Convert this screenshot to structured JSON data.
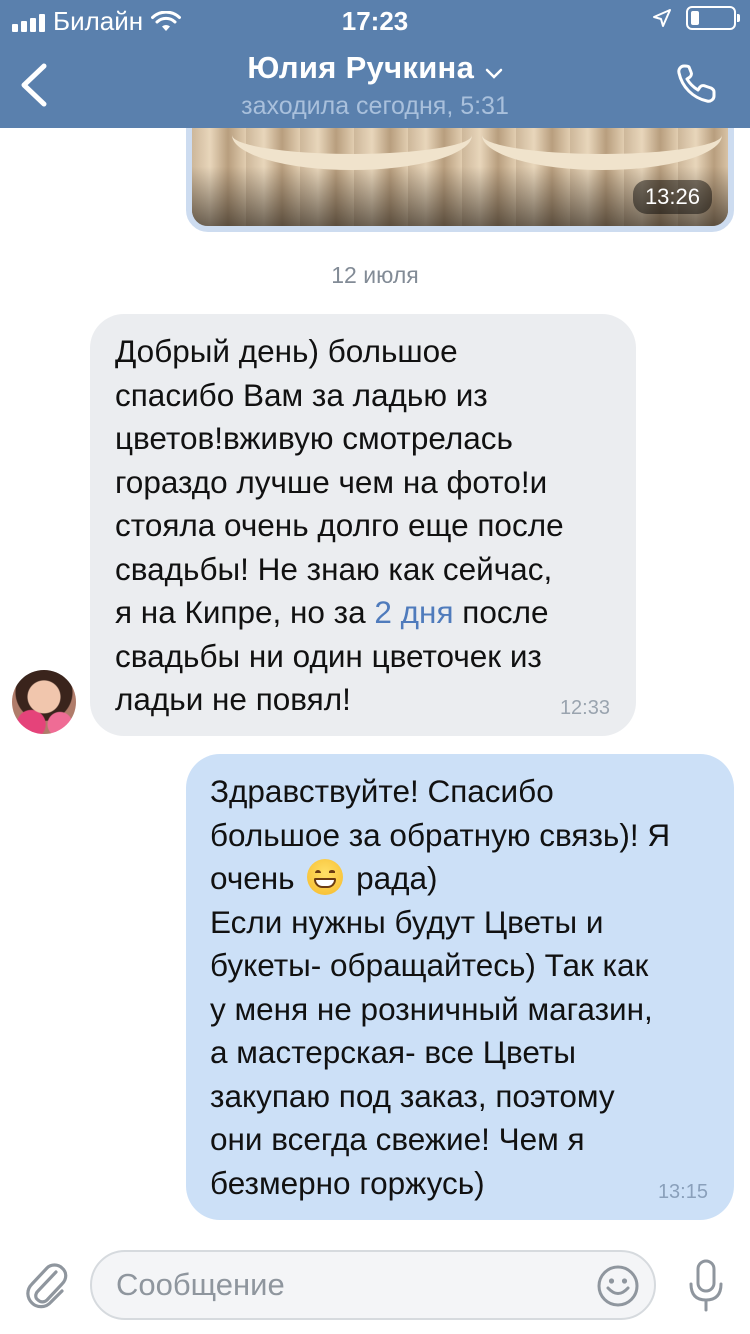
{
  "status_bar": {
    "carrier": "Билайн",
    "time": "17:23"
  },
  "header": {
    "contact_name": "Юлия Ручкина",
    "last_seen": "заходила сегодня, 5:31"
  },
  "photo_message": {
    "time": "13:26"
  },
  "date_separator": "12 июля",
  "incoming_message": {
    "lines": [
      "Добрый день) большое",
      "спасибо Вам за ладью из",
      "цветов!вживую смотрелась",
      "гораздо лучше чем на фото!и",
      "стояла очень долго еще после",
      "свадьбы! Не знаю как сейчас,",
      "я на Кипре,  но за ",
      "2 дня",
      " после",
      "свадьбы ни один цветочек из",
      "ладьи не повял!"
    ],
    "time": "12:33"
  },
  "outgoing_message": {
    "lines": [
      "Здравствуйте! Спасибо",
      "большое за обратную связь)! Я",
      "очень ",
      " рада)",
      "Если нужны будут Цветы и",
      "букеты- обращайтесь) Так как",
      "у меня не розничный магазин,",
      "а мастерская- все Цветы",
      "закупаю под заказ, поэтому",
      "они всегда свежие! Чем я",
      "безмерно горжусь)"
    ],
    "emoji": "grinning-face-emoji",
    "time": "13:15"
  },
  "composer": {
    "placeholder": "Сообщение",
    "value": ""
  },
  "colors": {
    "header_bg": "#5a80ad",
    "incoming_bubble": "#ebedf0",
    "outgoing_bubble": "#cce0f7",
    "link": "#4f7bbc"
  },
  "icons": [
    "back-icon",
    "chevron-down-icon",
    "phone-icon",
    "location-arrow-icon",
    "wifi-icon",
    "battery-icon",
    "attach-icon",
    "emoji-icon",
    "mic-icon"
  ]
}
